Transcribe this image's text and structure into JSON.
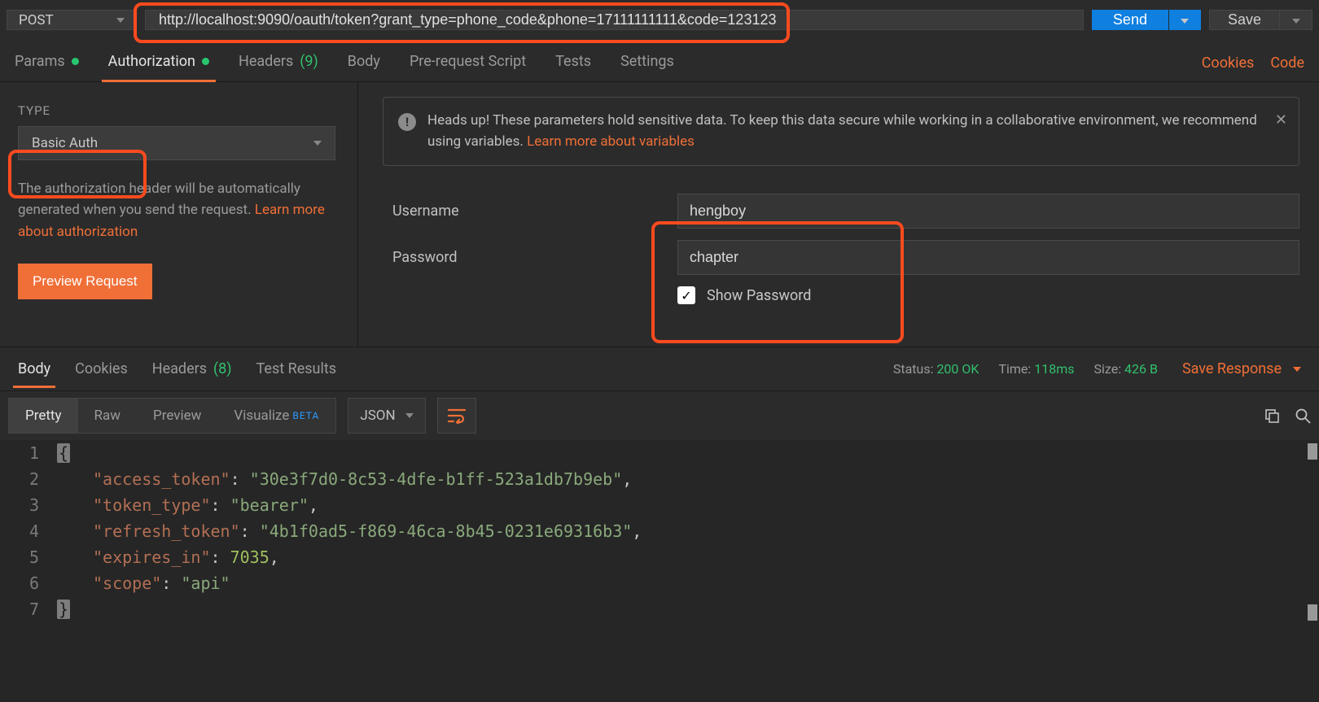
{
  "request": {
    "method": "POST",
    "url": "http://localhost:9090/oauth/token?grant_type=phone_code&phone=17111111111&code=123123",
    "send_label": "Send",
    "save_label": "Save"
  },
  "tabs": {
    "items": [
      {
        "label": "Params",
        "dot": true
      },
      {
        "label": "Authorization",
        "dot": true,
        "active": true
      },
      {
        "label": "Headers",
        "count": "(9)"
      },
      {
        "label": "Body"
      },
      {
        "label": "Pre-request Script"
      },
      {
        "label": "Tests"
      },
      {
        "label": "Settings"
      }
    ],
    "cookies": "Cookies",
    "code": "Code"
  },
  "auth": {
    "type_label": "TYPE",
    "type_value": "Basic Auth",
    "desc_1": "The authorization header will be automatically generated when you send the request. ",
    "desc_link": "Learn more about authorization",
    "preview_btn": "Preview Request",
    "alert_text": "Heads up! These parameters hold sensitive data. To keep this data secure while working in a collaborative environment, we recommend using variables. ",
    "alert_link": "Learn more about variables",
    "username_label": "Username",
    "username_value": "hengboy",
    "password_label": "Password",
    "password_value": "chapter",
    "show_password_label": "Show Password",
    "show_password_checked": true
  },
  "response": {
    "tabs": [
      {
        "label": "Body",
        "active": true
      },
      {
        "label": "Cookies"
      },
      {
        "label": "Headers",
        "count": "(8)"
      },
      {
        "label": "Test Results"
      }
    ],
    "status_label": "Status:",
    "status_value": "200 OK",
    "time_label": "Time:",
    "time_value": "118ms",
    "size_label": "Size:",
    "size_value": "426 B",
    "save_response": "Save Response",
    "viewer": {
      "modes": [
        "Pretty",
        "Raw",
        "Preview"
      ],
      "visualize": "Visualize",
      "beta": "BETA",
      "format": "JSON"
    },
    "body": {
      "access_token": "30e3f7d0-8c53-4dfe-b1ff-523a1db7b9eb",
      "token_type": "bearer",
      "refresh_token": "4b1f0ad5-f869-46ca-8b45-0231e69316b3",
      "expires_in": 7035,
      "scope": "api"
    }
  }
}
